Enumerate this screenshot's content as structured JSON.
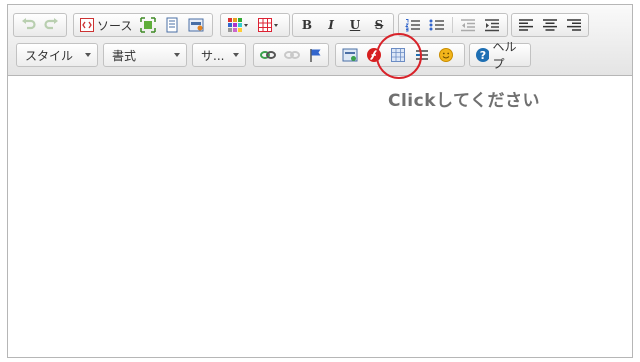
{
  "toolbar": {
    "row1": {
      "undo_icon": "undo-arrow",
      "redo_icon": "redo-arrow",
      "source_label": "ソース",
      "bold_label": "B",
      "italic_label": "I",
      "underline_label": "U",
      "strike_label": "S"
    },
    "row2": {
      "style_combo": "スタイル",
      "format_combo": "書式",
      "size_combo": "サ...",
      "help_label": "ヘルプ"
    }
  },
  "annotation": {
    "callout_text": "Clickしてください",
    "circle_color": "#d8232a"
  },
  "colors": {
    "link_green": "#3aa14b",
    "flash_red": "#d61f1f",
    "help_blue": "#1e6fb3",
    "smiley_yellow": "#f2b51b"
  }
}
